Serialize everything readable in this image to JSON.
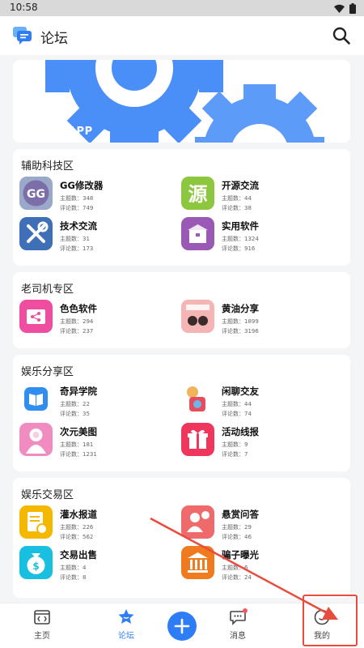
{
  "status_bar": {
    "time": "10:58"
  },
  "header": {
    "title": "论坛"
  },
  "banner": {
    "label": "APP"
  },
  "sections": [
    {
      "title": "辅助科技区",
      "boards": [
        {
          "name": "GG修改器",
          "topics": "主题数：348",
          "comments": "评论数：749",
          "icon": "gg-modifier-icon"
        },
        {
          "name": "开源交流",
          "topics": "主题数：44",
          "comments": "评论数：38",
          "icon": "open-source-icon"
        },
        {
          "name": "技术交流",
          "topics": "主题数：31",
          "comments": "评论数：173",
          "icon": "tools-icon"
        },
        {
          "name": "实用软件",
          "topics": "主题数：1324",
          "comments": "评论数：916",
          "icon": "box-icon"
        }
      ]
    },
    {
      "title": "老司机专区",
      "boards": [
        {
          "name": "色色软件",
          "topics": "主题数：294",
          "comments": "评论数：237",
          "icon": "share-folder-icon"
        },
        {
          "name": "黄油分享",
          "topics": "主题数：1899",
          "comments": "评论数：3196",
          "icon": "anime-pair-icon"
        }
      ]
    },
    {
      "title": "娱乐分享区",
      "boards": [
        {
          "name": "奇异学院",
          "topics": "主题数：22",
          "comments": "评论数：35",
          "icon": "book-icon"
        },
        {
          "name": "闲聊交友",
          "topics": "主题数：44",
          "comments": "评论数：74",
          "icon": "cartoon-cat-icon"
        },
        {
          "name": "次元美图",
          "topics": "主题数：181",
          "comments": "评论数：1231",
          "icon": "anime-girl-icon"
        },
        {
          "name": "活动线报",
          "topics": "主题数：9",
          "comments": "评论数：7",
          "icon": "gift-icon"
        }
      ]
    },
    {
      "title": "娱乐交易区",
      "boards": [
        {
          "name": "灌水报道",
          "topics": "主题数：226",
          "comments": "评论数：562",
          "icon": "document-clock-icon"
        },
        {
          "name": "悬赏问答",
          "topics": "主题数：29",
          "comments": "评论数：46",
          "icon": "user-question-icon"
        },
        {
          "name": "交易出售",
          "topics": "主题数：4",
          "comments": "评论数：8",
          "icon": "money-bag-icon"
        },
        {
          "name": "骗子曝光",
          "topics": "主题数：6",
          "comments": "评论数：24",
          "icon": "bank-icon"
        }
      ]
    }
  ],
  "bottom_nav": {
    "home": "主页",
    "forum": "论坛",
    "messages": "消息",
    "mine": "我的"
  },
  "colors": {
    "accent": "#2f7df6",
    "annotation": "#e74c3c",
    "banner_gear": "#4a8ff7"
  }
}
